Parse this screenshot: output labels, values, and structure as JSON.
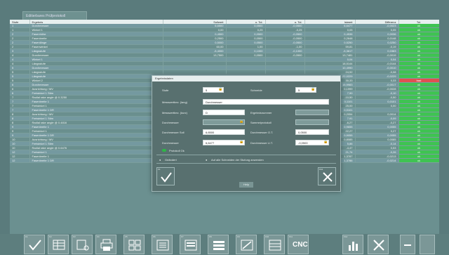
{
  "window": {
    "tab_label": "Editierbares Prüfprotokoll"
  },
  "table": {
    "columns": [
      "Stufe",
      "Ergebnis",
      "Sollwert",
      "o. Tol.",
      "u. Tol.",
      "Istwert",
      "Differenz",
      "Tol."
    ],
    "rows": [
      [
        "1",
        "Durchmesser",
        "6,6500",
        "0,0500",
        "-0,0500",
        "6,6477",
        "-0,0023",
        "ok"
      ],
      [
        "1",
        "Winkel 1",
        "0,00",
        "0,25",
        "-0,25",
        "0,05",
        "0,05",
        "ok"
      ],
      [
        "2",
        "Fasenhöhe",
        "0,4500",
        "0,0500",
        "-0,0500",
        "0,4536",
        "0,0036",
        "ok"
      ],
      [
        "2",
        "Fasenbreite",
        "0,2500",
        "0,0500",
        "-0,0500",
        "0,2648",
        "0,0148",
        "ok"
      ],
      [
        "2",
        "Fasenlänge",
        "0,5000",
        "0,0500",
        "-0,0500",
        "0,5250",
        "0,0250",
        "ok"
      ],
      [
        "2",
        "Fasenwinkel",
        "60,00",
        "1,00",
        "-1,00",
        "59,81",
        "-0,19",
        "ok"
      ],
      [
        "3",
        "Längsstufe",
        "-5,4000",
        "0,1000",
        "-0,1000",
        "-5,3617",
        "0,0383",
        "ok"
      ],
      [
        "4",
        "Durchmesser",
        "13,7500",
        "0,0500",
        "-0,0500",
        "13,7481",
        "-0,0019",
        "ok"
      ],
      [
        "4",
        "Winkel 1",
        "",
        "",
        "",
        "0,04",
        "0,04",
        "ok"
      ],
      [
        "4",
        "Längsstufe",
        "",
        "",
        "",
        "18,5144",
        "-0,0144",
        "ok"
      ],
      [
        "5",
        "Durchmesser",
        "",
        "",
        "",
        "10,4990",
        "-0,0010",
        "ok"
      ],
      [
        "5",
        "Längsstufe",
        "",
        "",
        "",
        "24,92",
        "-0,08",
        "ok"
      ],
      [
        "5",
        "Längsstufe",
        "",
        "",
        "",
        "-22,0229",
        "-0,0229",
        "ok"
      ],
      [
        "5",
        "Winkel 2",
        "",
        "",
        "",
        "30,33",
        "0,33",
        "bad"
      ],
      [
        "6",
        "Durchmesser",
        "",
        "",
        "",
        "15,9983",
        "-0,0017",
        "ok"
      ],
      [
        "6",
        "Ausrichtung / MV",
        "",
        "",
        "",
        "0,1999",
        "-0,0028",
        "ok"
      ],
      [
        "6",
        "Freiwinkel 1 Stirn",
        "",
        "",
        "",
        "7,90",
        "-0,10",
        "ok"
      ],
      [
        "7",
        "Radial rake angle @ 0.3250",
        "",
        "",
        "",
        "-10,50",
        "-0,50",
        "ok"
      ],
      [
        "7",
        "Fasenbreite 1",
        "",
        "",
        "",
        "0,1101",
        "0,0101",
        "ok"
      ],
      [
        "7",
        "Freiwinkel 1",
        "",
        "",
        "",
        "25,00",
        "0,00",
        "ok"
      ],
      [
        "7",
        "Fasenbreite 1 DR",
        "",
        "",
        "",
        "0,0101",
        "",
        "ok"
      ],
      [
        "8",
        "Ausrichtung / MV",
        "",
        "",
        "",
        "0,2054",
        "0,0014",
        "ok"
      ],
      [
        "8",
        "Freiwinkel 1 Stirn",
        "",
        "",
        "",
        "7,91",
        "-0,09",
        "ok"
      ],
      [
        "8",
        "Radial rake angle @ 0.4816",
        "",
        "",
        "",
        "-6,27",
        "-0,27",
        "ok"
      ],
      [
        "9",
        "Fasenbreite 1",
        "",
        "",
        "",
        "0,9655",
        "0,0055",
        "ok"
      ],
      [
        "9",
        "Freiwinkel 1",
        "",
        "",
        "",
        "22,27",
        "0,27",
        "ok"
      ],
      [
        "9",
        "Fasenbreite 1 DR",
        "",
        "",
        "",
        "0,9055",
        "0,0055",
        "ok"
      ],
      [
        "10",
        "Ausrichtung / MV",
        "",
        "",
        "",
        "0,8085",
        "0,0085",
        "ok"
      ],
      [
        "10",
        "Freiwinkel 1 Stirn",
        "",
        "",
        "",
        "5,86",
        "-0,14",
        "ok"
      ],
      [
        "10",
        "Radial rake angle @ 0.6476",
        "-5,00",
        "1,00",
        "-1,00",
        "-4,47",
        "0,53",
        "ok"
      ],
      [
        "12",
        "Freiwinkel 1",
        "22,00",
        "1,00",
        "-1,00",
        "21,74",
        "-0,26",
        "ok"
      ],
      [
        "12",
        "Fasenbreite 1",
        "1,4000",
        "0,1000",
        "-0,1000",
        "1,3787",
        "-0,0213",
        "ok"
      ],
      [
        "12",
        "Fasenbreite 1 DR",
        "1,4000",
        "0,1000",
        "-0,1000",
        "1,3786",
        "-0,0214",
        "ok"
      ]
    ]
  },
  "dialog": {
    "title": "Ergebnisdaten",
    "stufe_label": "Stufe",
    "stufe_value": "5",
    "schneide_label": "Schneide",
    "schneide_value": "5",
    "messwert_bez_label": "Messwertbez. (lang)",
    "messwert_bez_value": "Durchmesser",
    "messwert_kurz_label": "Messwertbez. (kurz)",
    "messwert_kurz_value": "D",
    "ergebnisnummer_label": "Ergebnisnummer",
    "ergebnisnummer_value": "",
    "durchmesser_label": "Durchmesser",
    "durchmesser_value": "",
    "sammelprotokoll_label": "Sammelprotokoll",
    "sammelprotokoll_value": "",
    "soll_label": "Durchmesser Soll",
    "soll_value": "6,6500",
    "otol_label": "Durchmesser O.T.",
    "otol_value": "0,0500",
    "ist_label": "Durchmesser",
    "ist_value": "6,6477",
    "utol_label": "Durchmesser U.T.",
    "utol_value": "-0,0500",
    "checkbox_label": "Protokoll Ok",
    "option1_label": "Geändert",
    "option2_label": "Auf alle Schneiden der Stufung anwenden",
    "ok_label": "F1",
    "cancel_label": "F12",
    "help_label": "Help"
  },
  "toolbar": {
    "keys": [
      "F1",
      "F2",
      "F3",
      "F4",
      "F5",
      "F6",
      "F7",
      "F8",
      "F9",
      "F10",
      "F11",
      "F12"
    ],
    "cnc_label": "CNC",
    "right_label1": "",
    "right_label2": ""
  },
  "colors": {
    "ok": "#3fc352",
    "bad": "#e05050",
    "bg": "#5a7b7c"
  }
}
